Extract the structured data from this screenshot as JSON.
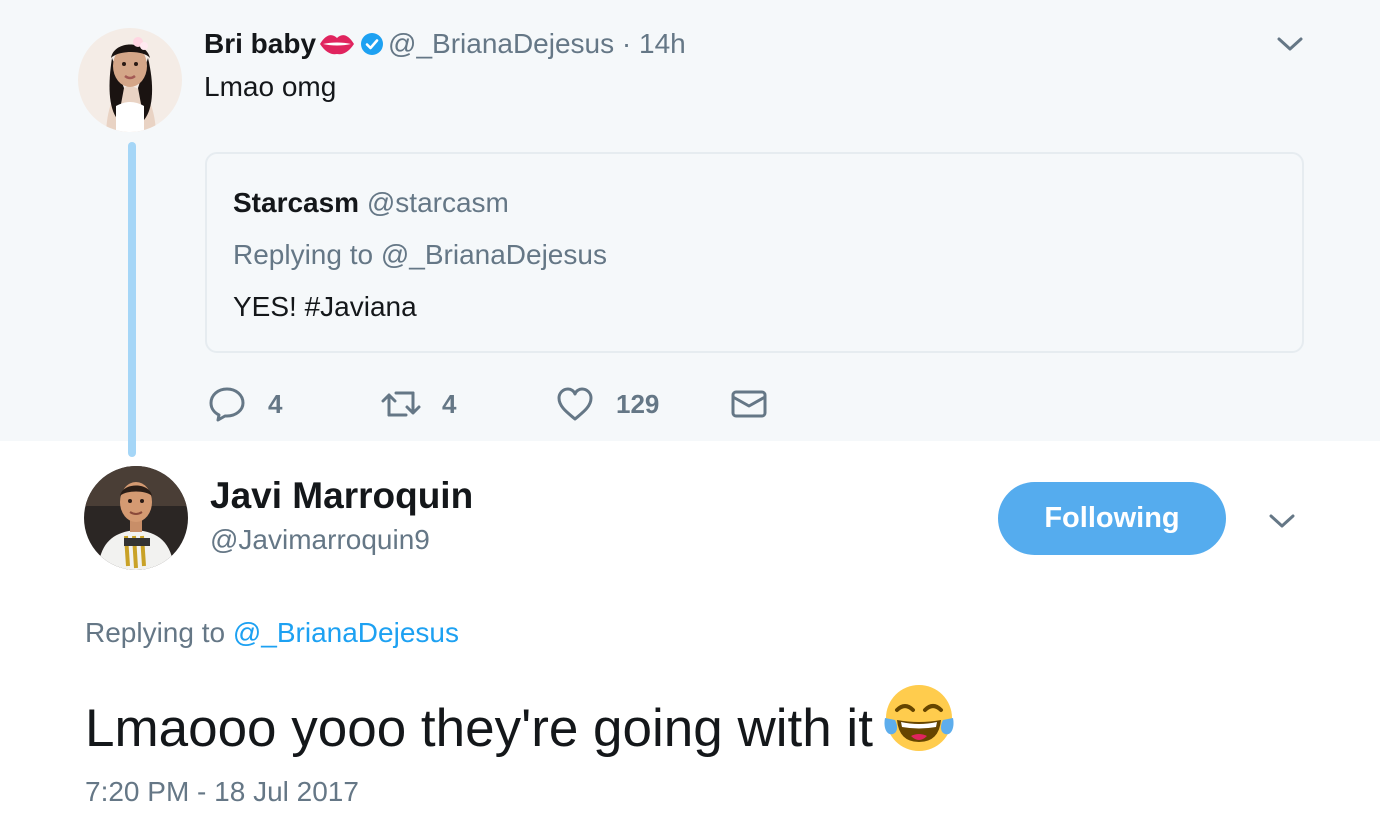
{
  "parent_tweet": {
    "author_name": "Bri baby",
    "author_handle": "@_BrianaDejesus",
    "separator": "·",
    "time": "14h",
    "text": "Lmao omg",
    "quoted_tweet": {
      "author_name": "Starcasm",
      "author_handle": "@starcasm",
      "replying_to": "Replying to @_BrianaDejesus",
      "text": "YES! #Javiana"
    },
    "actions": {
      "replies": "4",
      "retweets": "4",
      "likes": "129"
    }
  },
  "main_tweet": {
    "author_name": "Javi Marroquin",
    "author_handle": "@Javimarroquin9",
    "follow_button": "Following",
    "replying_prefix": "Replying to",
    "replying_mention": "@_BrianaDejesus",
    "text": "Lmaooo yooo they're going with it",
    "timestamp": "7:20 PM - 18 Jul 2017"
  },
  "colors": {
    "accent": "#1da1f2",
    "follow_button": "#55acee",
    "thread_line": "#a5d6f7",
    "muted_text": "#657786",
    "context_background": "#f5f8fa"
  },
  "icons": {
    "reply": "reply-icon",
    "retweet": "retweet-icon",
    "like": "heart-icon",
    "dm": "envelope-icon",
    "verified": "verified-badge-icon",
    "kiss": "kiss-lips-icon",
    "emoji": "tears-of-joy-emoji",
    "menu": "chevron-down-icon"
  }
}
